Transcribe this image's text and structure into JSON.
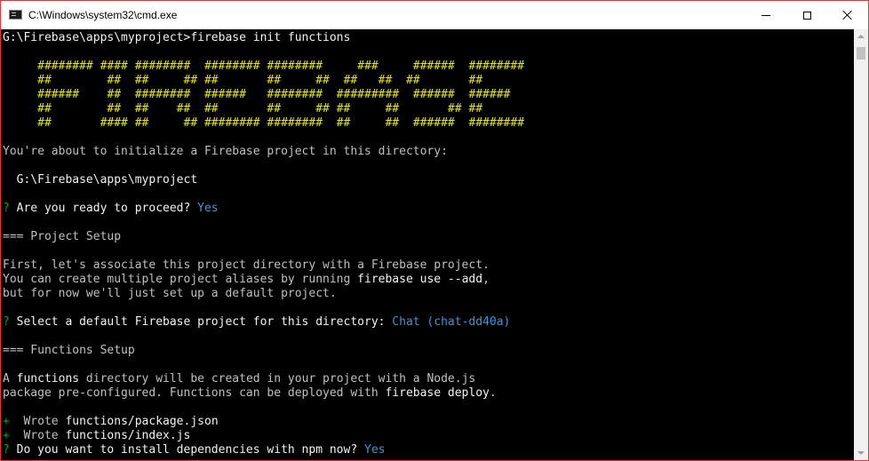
{
  "window": {
    "title": "C:\\Windows\\system32\\cmd.exe"
  },
  "console": {
    "lines": [
      [
        {
          "t": "G:\\Firebase\\apps\\myproject>firebase init functions",
          "c": "w"
        }
      ],
      [
        {
          "t": " ",
          "c": ""
        }
      ],
      [
        {
          "t": "     ######## #### ########  ######## ########     ###     ######  ########",
          "c": "y"
        }
      ],
      [
        {
          "t": "     ##        ##  ##     ## ##       ##     ##  ##   ##  ##       ##",
          "c": "y"
        }
      ],
      [
        {
          "t": "     ######    ##  ########  ######   ########  #########  ######  ######",
          "c": "y"
        }
      ],
      [
        {
          "t": "     ##        ##  ##    ##  ##       ##     ## ##     ##       ## ##",
          "c": "y"
        }
      ],
      [
        {
          "t": "     ##       #### ##     ## ######## ########  ##     ##  ######  ########",
          "c": "y"
        }
      ],
      [
        {
          "t": " ",
          "c": ""
        }
      ],
      [
        {
          "t": "You're about to initialize a Firebase project in this directory:",
          "c": ""
        }
      ],
      [
        {
          "t": " ",
          "c": ""
        }
      ],
      [
        {
          "t": "  G:\\Firebase\\apps\\myproject",
          "c": "w"
        }
      ],
      [
        {
          "t": " ",
          "c": ""
        }
      ],
      [
        {
          "t": "? ",
          "c": "g"
        },
        {
          "t": "Are you ready to proceed? ",
          "c": "w"
        },
        {
          "t": "Yes",
          "c": "c"
        }
      ],
      [
        {
          "t": " ",
          "c": ""
        }
      ],
      [
        {
          "t": "=== Project Setup",
          "c": ""
        }
      ],
      [
        {
          "t": " ",
          "c": ""
        }
      ],
      [
        {
          "t": "First, let's associate this project directory with a Firebase project.",
          "c": ""
        }
      ],
      [
        {
          "t": "You can create multiple project aliases by running ",
          "c": ""
        },
        {
          "t": "firebase use --add",
          "c": "w"
        },
        {
          "t": ",",
          "c": ""
        }
      ],
      [
        {
          "t": "but for now we'll just set up a default project.",
          "c": ""
        }
      ],
      [
        {
          "t": " ",
          "c": ""
        }
      ],
      [
        {
          "t": "? ",
          "c": "g"
        },
        {
          "t": "Select a default Firebase project for this directory: ",
          "c": "w"
        },
        {
          "t": "Chat (chat-dd40a)",
          "c": "c"
        }
      ],
      [
        {
          "t": " ",
          "c": ""
        }
      ],
      [
        {
          "t": "=== Functions Setup",
          "c": ""
        }
      ],
      [
        {
          "t": " ",
          "c": ""
        }
      ],
      [
        {
          "t": "A ",
          "c": ""
        },
        {
          "t": "functions",
          "c": "w"
        },
        {
          "t": " directory will be created in your project with a Node.js",
          "c": ""
        }
      ],
      [
        {
          "t": "package pre-configured. Functions can be deployed with ",
          "c": ""
        },
        {
          "t": "firebase deploy",
          "c": "w"
        },
        {
          "t": ".",
          "c": ""
        }
      ],
      [
        {
          "t": " ",
          "c": ""
        }
      ],
      [
        {
          "t": "+  ",
          "c": "g"
        },
        {
          "t": "Wrote ",
          "c": ""
        },
        {
          "t": "functions/package.json",
          "c": "w"
        }
      ],
      [
        {
          "t": "+  ",
          "c": "g"
        },
        {
          "t": "Wrote ",
          "c": ""
        },
        {
          "t": "functions/index.js",
          "c": "w"
        }
      ],
      [
        {
          "t": "? ",
          "c": "g"
        },
        {
          "t": "Do you want to install dependencies with npm now? ",
          "c": "w"
        },
        {
          "t": "Yes",
          "c": "c"
        }
      ]
    ]
  },
  "icons": {
    "app": "cmd-app-icon",
    "minimize": "minimize-icon",
    "maximize": "maximize-icon",
    "close": "close-icon",
    "scroll_up": "scroll-up-arrow-icon",
    "scroll_down": "scroll-down-arrow-icon"
  },
  "colors": {
    "console_bg": "#000000",
    "console_text": "#c0c0c0",
    "banner_yellow": "#e8e800",
    "prompt_green": "#13a10e",
    "answer_cyan": "#3a96dd",
    "window_border": "#d63b3b"
  }
}
